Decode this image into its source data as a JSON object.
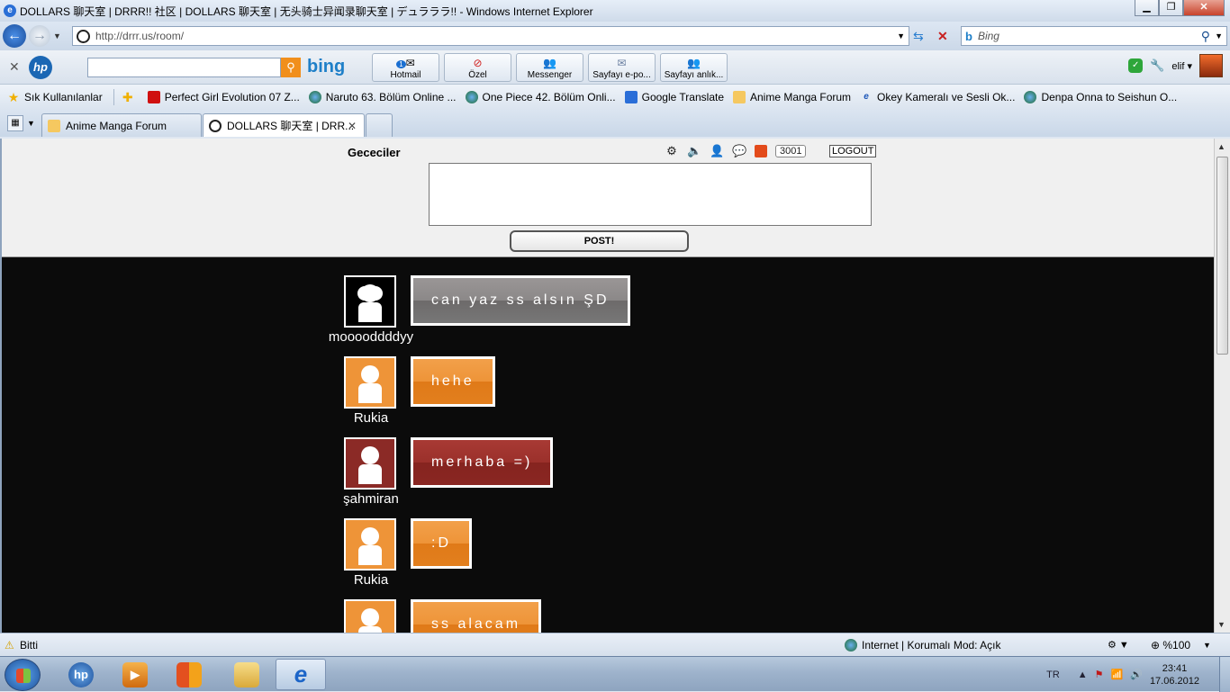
{
  "window": {
    "title": "DOLLARS 聊天室 | DRRR!! 社区 | DOLLARS 聊天室 | 无头骑士异闻录聊天室 | デュラララ!! - Windows Internet Explorer"
  },
  "address": {
    "url": "http://drrr.us/room/",
    "search_placeholder": "Bing"
  },
  "hp_toolbar": {
    "bing_label": "bing",
    "buttons": [
      {
        "label": "Hotmail",
        "icon": "mail-icon",
        "badge": "1"
      },
      {
        "label": "Özel",
        "icon": "stop-sign-icon"
      },
      {
        "label": "Messenger",
        "icon": "messenger-icon"
      },
      {
        "label": "Sayfayı e-po...",
        "icon": "email-page-icon"
      },
      {
        "label": "Sayfayı anlık...",
        "icon": "share-page-icon"
      }
    ],
    "user": "elif"
  },
  "favorites": {
    "label": "Sık Kullanılanlar",
    "items": [
      {
        "label": "Perfect Girl Evolution 07 Z...",
        "icon": "youtube-icon"
      },
      {
        "label": "Naruto 63. Bölüm Online ...",
        "icon": "globe-icon"
      },
      {
        "label": "One Piece 42. Bölüm Onli...",
        "icon": "globe-icon"
      },
      {
        "label": "Google Translate",
        "icon": "translate-icon"
      },
      {
        "label": "Anime Manga Forum",
        "icon": "anime-icon"
      },
      {
        "label": "Okey  Kameralı ve Sesli Ok...",
        "icon": "ie-icon"
      },
      {
        "label": "Denpa Onna to Seishun O...",
        "icon": "globe-icon"
      }
    ]
  },
  "tabs": [
    {
      "label": "Anime Manga Forum",
      "active": false
    },
    {
      "label": "DOLLARS 聊天室 | DRR...",
      "active": true
    }
  ],
  "room": {
    "name": "Gececiler",
    "count": "3001",
    "logout_label": "LOGOUT",
    "post_label": "POST!",
    "message_value": ""
  },
  "talks": [
    {
      "user": "mooooddddyy",
      "message": "can yaz ss alsın ŞD",
      "avatar": "headphones-avatar",
      "color": "grey"
    },
    {
      "user": "Rukia",
      "message": "hehe",
      "avatar": "girl-braids-avatar",
      "color": "orange"
    },
    {
      "user": "şahmiran",
      "message": "merhaba =)",
      "avatar": "nurse-avatar",
      "color": "red"
    },
    {
      "user": "Rukia",
      "message": ":D",
      "avatar": "girl-braids-avatar",
      "color": "orange"
    },
    {
      "user": "",
      "message": "ss alacam",
      "avatar": "girl-braids-avatar",
      "color": "orange"
    }
  ],
  "status": {
    "text": "Bitti",
    "zone": "Internet | Korumalı Mod: Açık",
    "zoom": "%100"
  },
  "taskbar": {
    "lang": "TR",
    "time": "23:41",
    "date": "17.06.2012"
  },
  "colors": {
    "chat_background": "#0b0b0b",
    "bubble_grey": "#8b8888",
    "bubble_orange": "#ee9438",
    "bubble_red": "#9b302b"
  }
}
